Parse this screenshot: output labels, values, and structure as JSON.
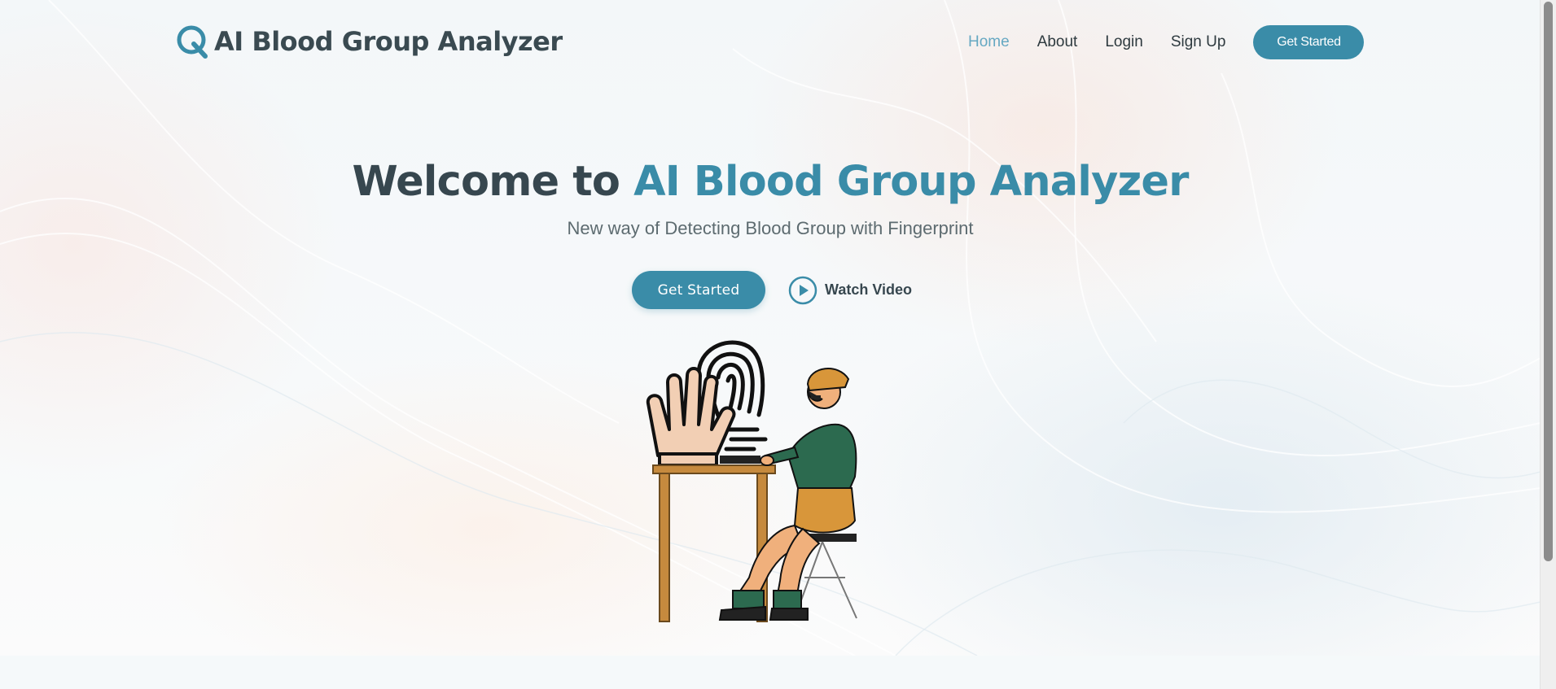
{
  "brand": {
    "name": "AI Blood Group Analyzer",
    "icon": "q-logo-icon",
    "color": "#3a8ca8"
  },
  "nav": {
    "items": [
      {
        "label": "Home",
        "active": true
      },
      {
        "label": "About",
        "active": false
      },
      {
        "label": "Login",
        "active": false
      },
      {
        "label": "Sign Up",
        "active": false
      }
    ],
    "cta_label": "Get Started"
  },
  "hero": {
    "title_prefix": "Welcome to",
    "title_accent": "AI Blood Group Analyzer",
    "subtitle": "New way of Detecting Blood Group with Fingerprint",
    "cta_label": "Get Started",
    "watch_label": "Watch Video",
    "watch_icon": "play-circle-icon",
    "illustration": "fingerprint-scan-illustration"
  },
  "colors": {
    "accent": "#3a8ca8",
    "nav_active": "#66a8c2",
    "heading": "#37474f",
    "text": "#5d6b70"
  }
}
